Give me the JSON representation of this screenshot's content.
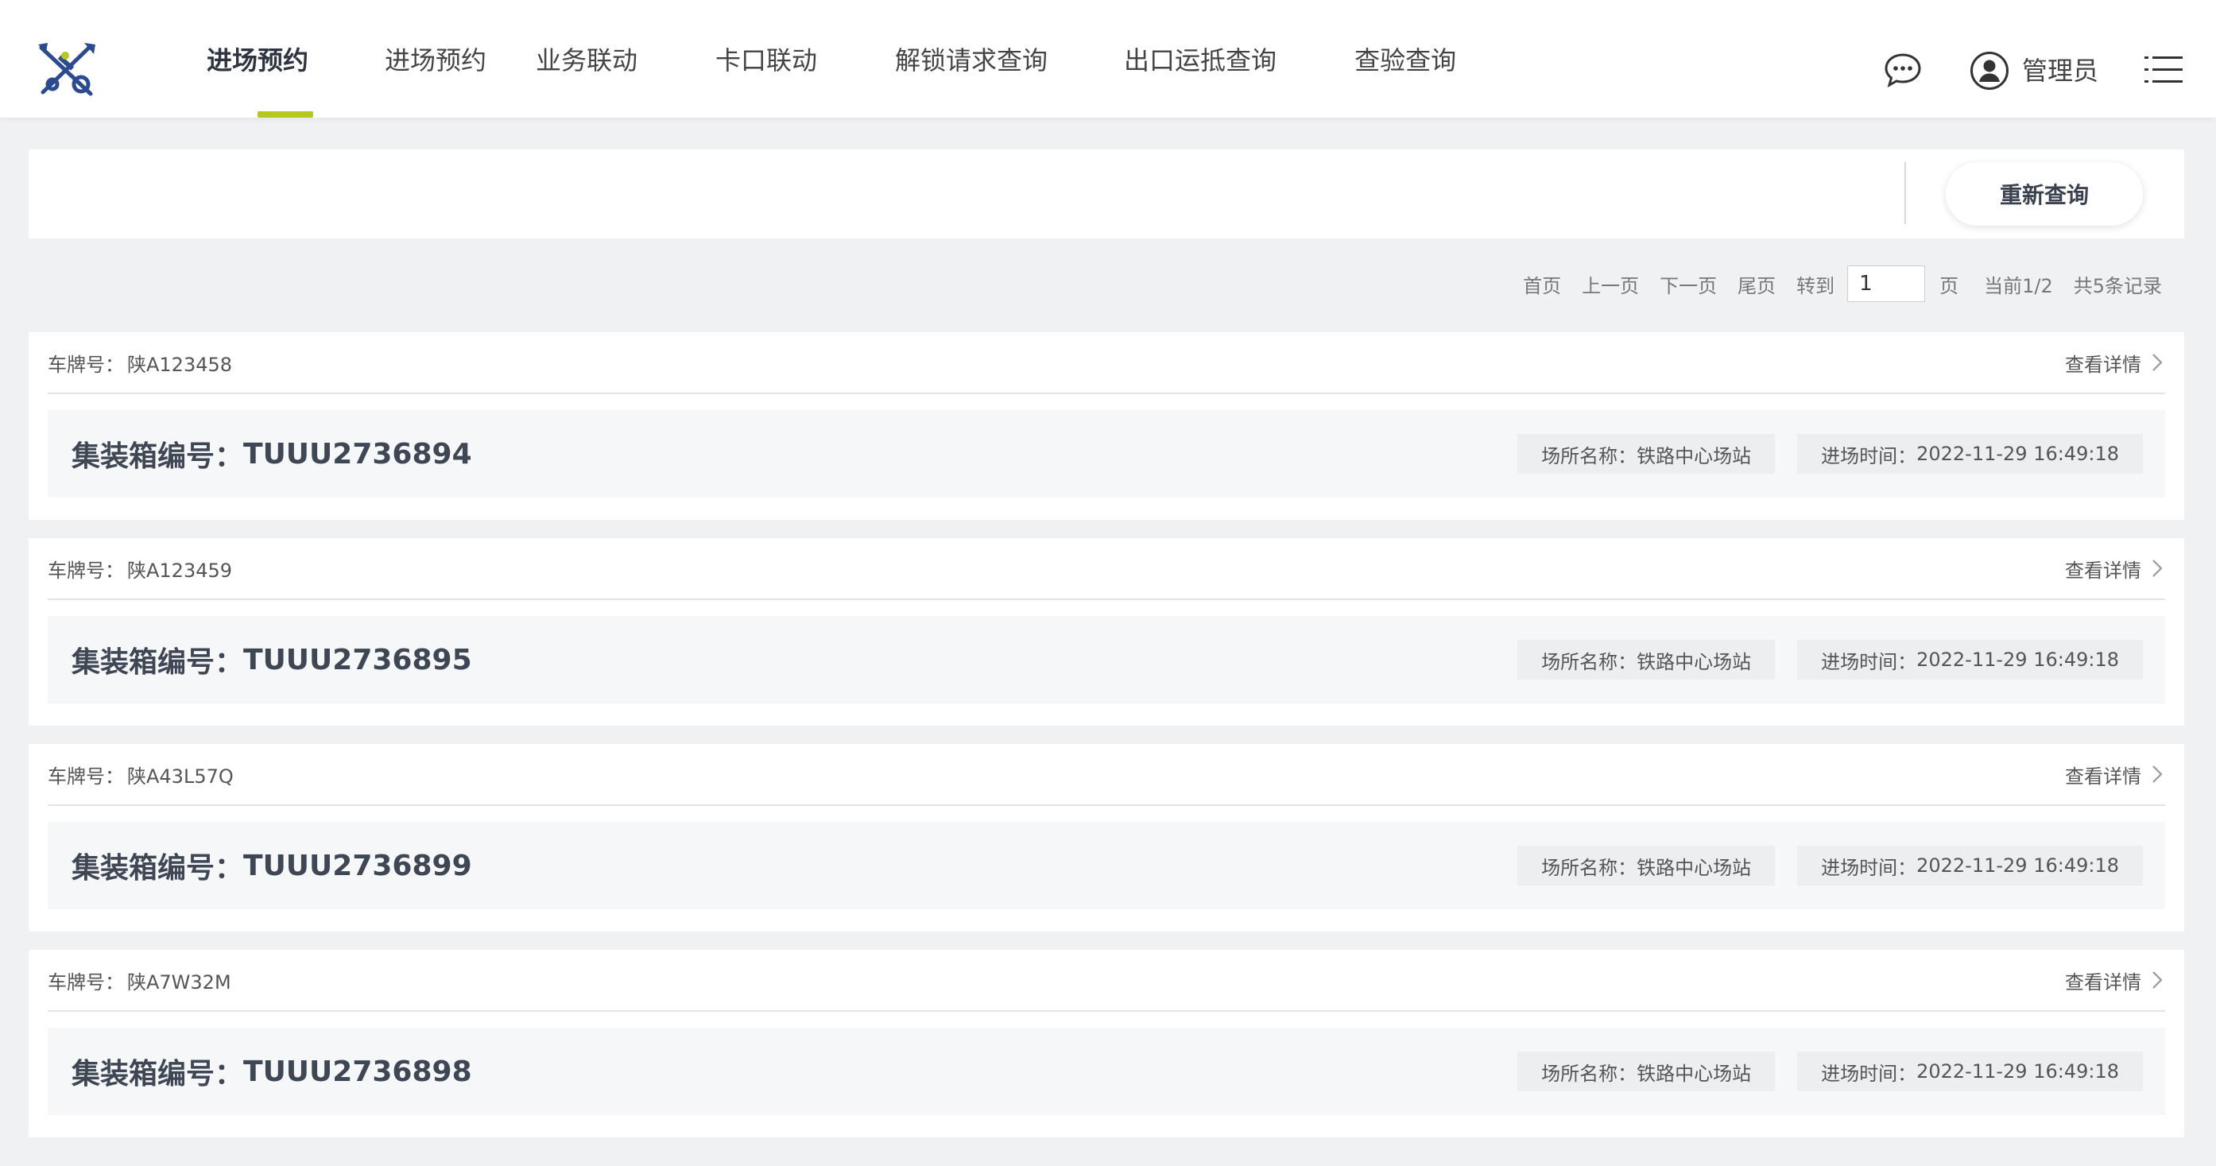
{
  "nav": {
    "items": [
      {
        "label": "进场预约",
        "active": true
      },
      {
        "label": "进场预约",
        "active": false
      },
      {
        "label": "业务联动",
        "active": false
      },
      {
        "label": "卡口联动",
        "active": false
      },
      {
        "label": "解锁请求查询",
        "active": false
      },
      {
        "label": "出口运抵查询",
        "active": false
      },
      {
        "label": "查验查询",
        "active": false
      }
    ]
  },
  "user": {
    "name": "管理员"
  },
  "search": {
    "requery_label": "重新查询"
  },
  "pagination": {
    "first": "首页",
    "prev": "上一页",
    "next": "下一页",
    "last": "尾页",
    "goto": "转到",
    "page_value": "1",
    "page_unit": "页",
    "current": "当前1/2",
    "total": "共5条记录"
  },
  "labels": {
    "plate": "车牌号：",
    "detail": "查看详情",
    "container": "集装箱编号：",
    "site": "场所名称：",
    "entry_time": "进场时间："
  },
  "records": [
    {
      "plate": "陕A123458",
      "container": "TUUU2736894",
      "site": "铁路中心场站",
      "entry_time": "2022-11-29 16:49:18"
    },
    {
      "plate": "陕A123459",
      "container": "TUUU2736895",
      "site": "铁路中心场站",
      "entry_time": "2022-11-29 16:49:18"
    },
    {
      "plate": "陕A43L57Q",
      "container": "TUUU2736899",
      "site": "铁路中心场站",
      "entry_time": "2022-11-29 16:49:18"
    },
    {
      "plate": "陕A7W32M",
      "container": "TUUU2736898",
      "site": "铁路中心场站",
      "entry_time": "2022-11-29 16:49:18"
    }
  ],
  "colors": {
    "accent": "#b4c81e",
    "logo": "#2b4a8f"
  }
}
